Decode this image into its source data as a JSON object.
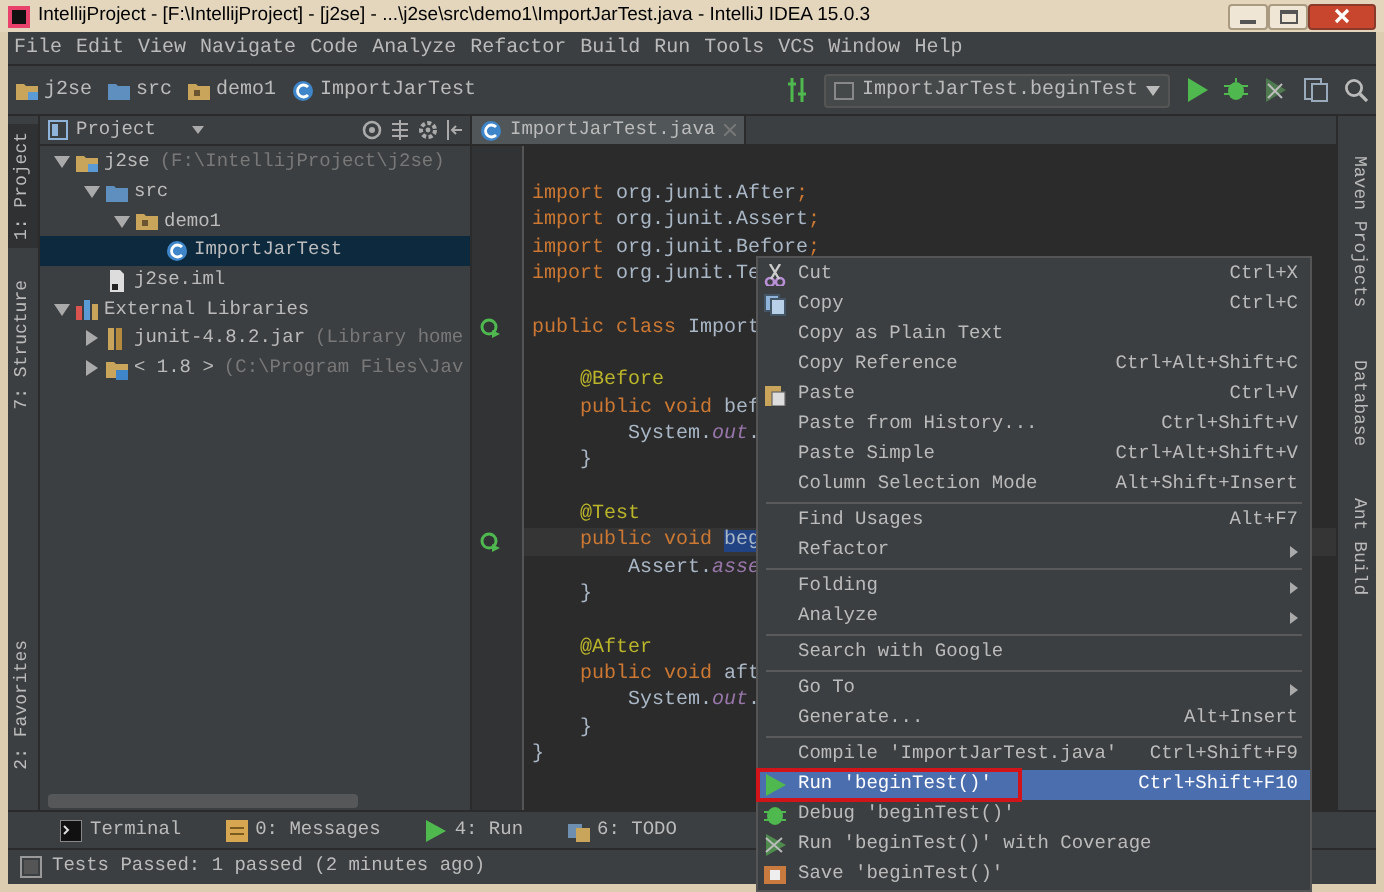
{
  "window": {
    "title": "IntellijProject - [F:\\IntellijProject] - [j2se] - ...\\j2se\\src\\demo1\\ImportJarTest.java - IntelliJ IDEA 15.0.3"
  },
  "menu_bar": [
    "File",
    "Edit",
    "View",
    "Navigate",
    "Code",
    "Analyze",
    "Refactor",
    "Build",
    "Run",
    "Tools",
    "VCS",
    "Window",
    "Help"
  ],
  "navigation": {
    "breadcrumbs": [
      {
        "label": "j2se",
        "kind": "module"
      },
      {
        "label": "src",
        "kind": "source-folder"
      },
      {
        "label": "demo1",
        "kind": "package"
      },
      {
        "label": "ImportJarTest",
        "kind": "test-class"
      }
    ],
    "run_config": "ImportJarTest.beginTest"
  },
  "left_tool_tabs": [
    {
      "label": "1: Project",
      "selected": true
    },
    {
      "label": "7: Structure",
      "selected": false
    },
    {
      "label": "2: Favorites",
      "selected": false
    }
  ],
  "project_panel": {
    "title": "Project",
    "tree": [
      {
        "label": "j2se",
        "hint": "(F:\\IntellijProject\\j2se)",
        "kind": "module",
        "selected": false,
        "expanded": true,
        "children": [
          {
            "label": "src",
            "kind": "source-folder",
            "selected": false,
            "expanded": true,
            "children": [
              {
                "label": "demo1",
                "kind": "package",
                "selected": false,
                "expanded": true,
                "children": [
                  {
                    "label": "ImportJarTest",
                    "kind": "test-class",
                    "selected": true
                  }
                ]
              }
            ]
          },
          {
            "label": "j2se.iml",
            "kind": "file",
            "selected": false
          }
        ]
      },
      {
        "label": "External Libraries",
        "kind": "libraries",
        "selected": false,
        "expanded": true,
        "children": [
          {
            "label": "junit-4.8.2.jar",
            "hint": "(Library home",
            "kind": "jar",
            "selected": false,
            "expanded": false
          },
          {
            "label": "< 1.8 >",
            "hint": "(C:\\Program Files\\Jav",
            "kind": "jdk",
            "selected": false,
            "expanded": false
          }
        ]
      }
    ]
  },
  "editor": {
    "tabs": [
      {
        "label": "ImportJarTest.java",
        "selected": true
      }
    ],
    "lines": [
      {
        "kind": "code",
        "run_marker": false,
        "tokens": [
          {
            "text": "import",
            "kind": "keyword"
          },
          {
            "text": " org.junit.After",
            "kind": "plain"
          },
          {
            "text": ";",
            "kind": "keyword"
          }
        ]
      },
      {
        "kind": "code",
        "run_marker": false,
        "tokens": [
          {
            "text": "import",
            "kind": "keyword"
          },
          {
            "text": " org.junit.Assert",
            "kind": "plain"
          },
          {
            "text": ";",
            "kind": "keyword"
          }
        ]
      },
      {
        "kind": "code",
        "run_marker": false,
        "tokens": [
          {
            "text": "import",
            "kind": "keyword"
          },
          {
            "text": " org.junit.Before",
            "kind": "plain"
          },
          {
            "text": ";",
            "kind": "keyword"
          }
        ]
      },
      {
        "kind": "code",
        "run_marker": false,
        "tokens": [
          {
            "text": "import",
            "kind": "keyword"
          },
          {
            "text": " org.junit.Te",
            "kind": "plain"
          }
        ]
      },
      {
        "kind": "blank",
        "run_marker": false
      },
      {
        "kind": "code",
        "run_marker": true,
        "tokens": [
          {
            "text": "public class",
            "kind": "keyword"
          },
          {
            "text": " Import",
            "kind": "plain"
          }
        ]
      },
      {
        "kind": "blank",
        "run_marker": false
      },
      {
        "kind": "code",
        "run_marker": false,
        "tokens": [
          {
            "text": "    @Before",
            "kind": "annotation"
          }
        ]
      },
      {
        "kind": "code",
        "run_marker": false,
        "tokens": [
          {
            "text": "    public void",
            "kind": "keyword"
          },
          {
            "text": " bef",
            "kind": "plain"
          }
        ]
      },
      {
        "kind": "code",
        "run_marker": false,
        "tokens": [
          {
            "text": "        System.",
            "kind": "plain"
          },
          {
            "text": "out",
            "kind": "field"
          },
          {
            "text": ".",
            "kind": "plain"
          }
        ]
      },
      {
        "kind": "code",
        "run_marker": false,
        "tokens": [
          {
            "text": "    }",
            "kind": "plain"
          }
        ]
      },
      {
        "kind": "blank",
        "run_marker": false
      },
      {
        "kind": "code",
        "run_marker": false,
        "tokens": [
          {
            "text": "    @Test",
            "kind": "annotation"
          }
        ]
      },
      {
        "kind": "caret",
        "run_marker": true,
        "tokens": [
          {
            "text": "    public void ",
            "kind": "keyword"
          },
          {
            "text": "beg",
            "kind": "selection"
          }
        ]
      },
      {
        "kind": "code",
        "run_marker": false,
        "tokens": [
          {
            "text": "        Assert.",
            "kind": "plain"
          },
          {
            "text": "asse",
            "kind": "field"
          }
        ]
      },
      {
        "kind": "code",
        "run_marker": false,
        "tokens": [
          {
            "text": "    }",
            "kind": "plain"
          }
        ]
      },
      {
        "kind": "blank",
        "run_marker": false
      },
      {
        "kind": "code",
        "run_marker": false,
        "tokens": [
          {
            "text": "    @After",
            "kind": "annotation"
          }
        ]
      },
      {
        "kind": "code",
        "run_marker": false,
        "tokens": [
          {
            "text": "    public void",
            "kind": "keyword"
          },
          {
            "text": " aft",
            "kind": "plain"
          }
        ]
      },
      {
        "kind": "code",
        "run_marker": false,
        "tokens": [
          {
            "text": "        System.",
            "kind": "plain"
          },
          {
            "text": "out",
            "kind": "field"
          },
          {
            "text": ".",
            "kind": "plain"
          }
        ]
      },
      {
        "kind": "code",
        "run_marker": false,
        "tokens": [
          {
            "text": "    }",
            "kind": "plain"
          }
        ]
      },
      {
        "kind": "code",
        "run_marker": false,
        "tokens": [
          {
            "text": "}",
            "kind": "plain"
          }
        ]
      }
    ]
  },
  "right_tool_tabs": [
    "Maven Projects",
    "Database",
    "Ant Build"
  ],
  "context_menu": {
    "items": [
      {
        "label": "Cut",
        "shortcut": "Ctrl+X",
        "kind": "cut",
        "selected": false,
        "outlined": false
      },
      {
        "label": "Copy",
        "shortcut": "Ctrl+C",
        "kind": "copy",
        "selected": false,
        "outlined": false
      },
      {
        "label": "Copy as Plain Text",
        "selected": false,
        "outlined": false
      },
      {
        "label": "Copy Reference",
        "shortcut": "Ctrl+Alt+Shift+C",
        "selected": false,
        "outlined": false
      },
      {
        "label": "Paste",
        "shortcut": "Ctrl+V",
        "kind": "paste",
        "selected": false,
        "outlined": false
      },
      {
        "label": "Paste from History...",
        "shortcut": "Ctrl+Shift+V",
        "selected": false,
        "outlined": false
      },
      {
        "label": "Paste Simple",
        "shortcut": "Ctrl+Alt+Shift+V",
        "selected": false,
        "outlined": false
      },
      {
        "label": "Column Selection Mode",
        "shortcut": "Alt+Shift+Insert",
        "selected": false,
        "outlined": false
      },
      {
        "label": "Find Usages",
        "shortcut": "Alt+F7",
        "separator_before": true,
        "selected": false,
        "outlined": false
      },
      {
        "label": "Refactor",
        "submenu": true,
        "selected": false,
        "outlined": false
      },
      {
        "label": "Folding",
        "submenu": true,
        "separator_before": true,
        "selected": false,
        "outlined": false
      },
      {
        "label": "Analyze",
        "submenu": true,
        "selected": false,
        "outlined": false
      },
      {
        "label": "Search with Google",
        "separator_before": true,
        "selected": false,
        "outlined": false
      },
      {
        "label": "Go To",
        "submenu": true,
        "separator_before": true,
        "selected": false,
        "outlined": false
      },
      {
        "label": "Generate...",
        "shortcut": "Alt+Insert",
        "selected": false,
        "outlined": false
      },
      {
        "label": "Compile 'ImportJarTest.java'",
        "shortcut": "Ctrl+Shift+F9",
        "separator_before": true,
        "selected": false,
        "outlined": false
      },
      {
        "label": "Run 'beginTest()'",
        "shortcut": "Ctrl+Shift+F10",
        "kind": "run",
        "selected": true,
        "outlined": true
      },
      {
        "label": "Debug 'beginTest()'",
        "kind": "debug",
        "selected": false,
        "outlined": false
      },
      {
        "label": "Run 'beginTest()' with Coverage",
        "kind": "coverage",
        "selected": false,
        "outlined": false
      },
      {
        "label": "Save 'beginTest()'",
        "kind": "save",
        "selected": false,
        "outlined": false
      }
    ]
  },
  "bottom_tool_tabs": [
    {
      "label": "Terminal",
      "kind": "terminal"
    },
    {
      "label": "0: Messages",
      "kind": "messages"
    },
    {
      "label": "4: Run",
      "kind": "run"
    },
    {
      "label": "6: TODO",
      "kind": "todo"
    }
  ],
  "status_bar": {
    "message": "Tests Passed: 1 passed (2 minutes ago)"
  }
}
